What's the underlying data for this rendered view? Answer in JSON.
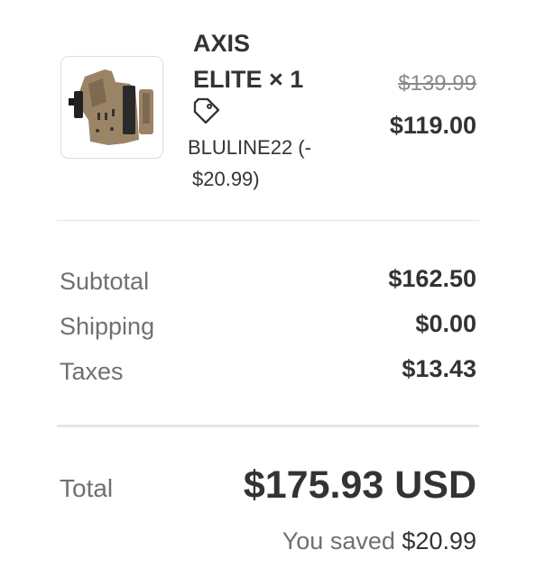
{
  "product": {
    "name_line1": "AXIS",
    "name_line2": "ELITE",
    "quantity": "× 1",
    "discount_code": "BLULINE22 (-",
    "discount_amount": "$20.99)",
    "original_price": "$139.99",
    "price": "$119.00",
    "image_icon": "holster-product-image",
    "tag_icon": "tag-icon"
  },
  "summary": {
    "rows": [
      {
        "label": "Subtotal",
        "value": "$162.50"
      },
      {
        "label": "Shipping",
        "value": "$0.00"
      },
      {
        "label": "Taxes",
        "value": "$13.43"
      }
    ],
    "total_label": "Total",
    "total_value": "$175.93 USD",
    "saved_prefix": "You saved",
    "saved_value": "$20.99"
  },
  "colors": {
    "text": "#333333",
    "muted": "#707070",
    "divider": "#e2e2e2",
    "holster": "#9b8466"
  }
}
